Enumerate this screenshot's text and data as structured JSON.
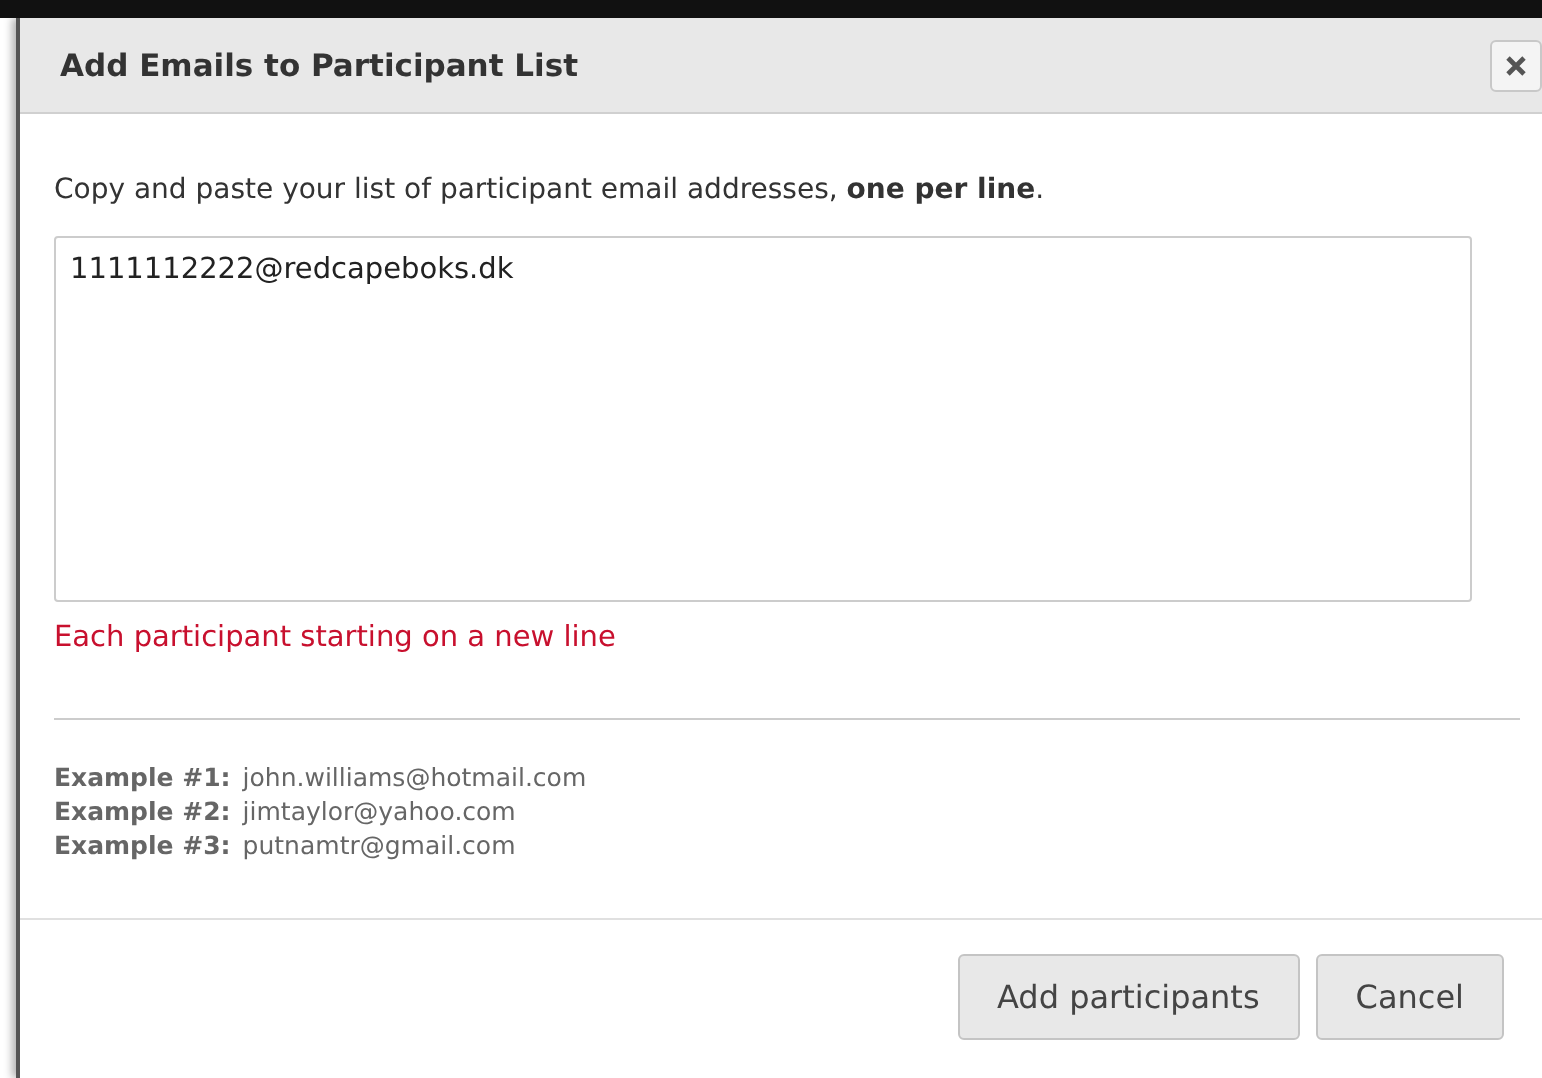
{
  "dialog": {
    "title": "Add Emails to Participant List"
  },
  "instructions": "Copy and paste your list of participant email addresses, **one per line**.",
  "emails_field": {
    "value": "1111112222@redcapeboks.dk"
  },
  "error": "Each participant starting on a new line",
  "examples": [
    {
      "label": "Example #1:",
      "email": "john.williams@hotmail.com"
    },
    {
      "label": "Example #2:",
      "email": "jimtaylor@yahoo.com"
    },
    {
      "label": "Example #3:",
      "email": "putnamtr@gmail.com"
    }
  ],
  "buttons": [
    {
      "label": "Add participants"
    },
    {
      "label": "Cancel"
    }
  ]
}
